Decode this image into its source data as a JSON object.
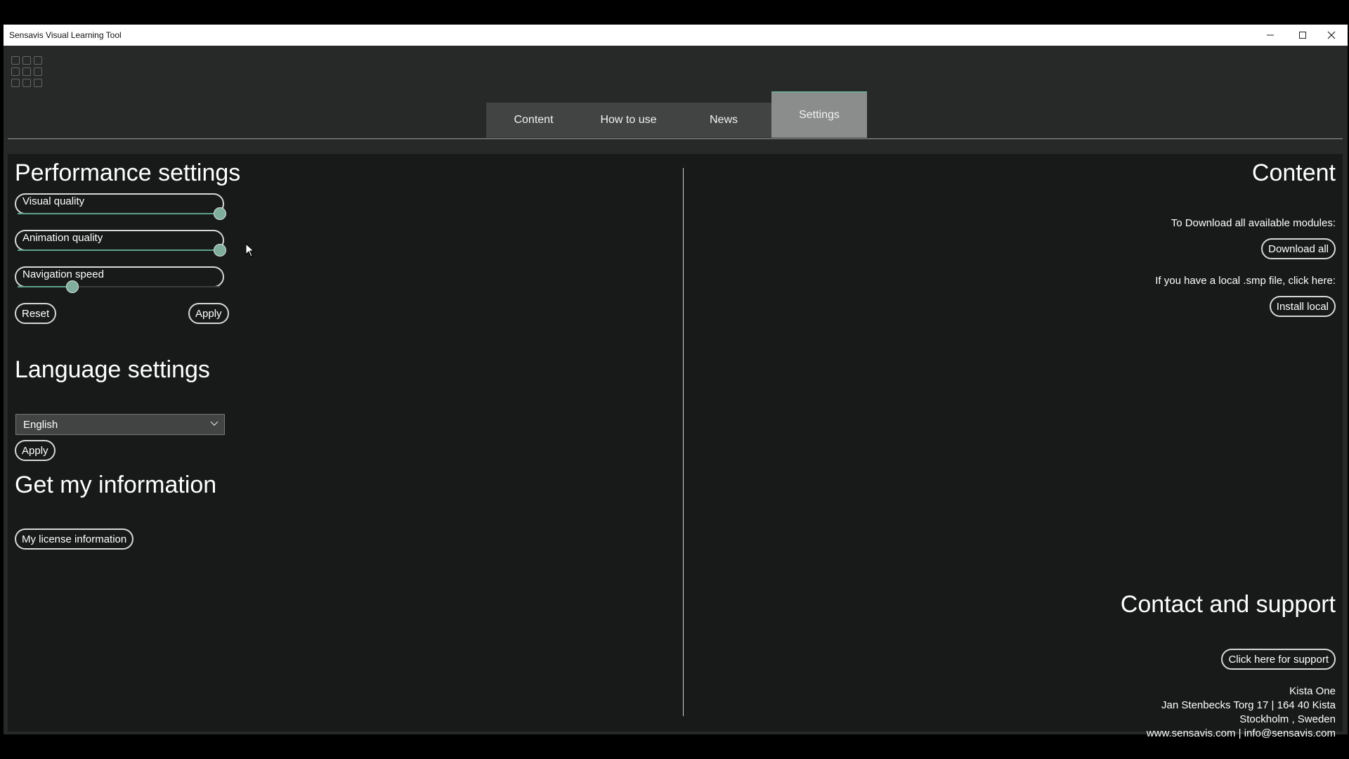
{
  "window": {
    "title": "Sensavis Visual Learning Tool"
  },
  "tabs": [
    {
      "label": "Content",
      "active": false
    },
    {
      "label": "How to use",
      "active": false
    },
    {
      "label": "News",
      "active": false
    },
    {
      "label": "Settings",
      "active": true
    }
  ],
  "performance": {
    "heading": "Performance settings",
    "sliders": [
      {
        "label": "Visual quality",
        "value_fraction": 1.0
      },
      {
        "label": "Animation quality",
        "value_fraction": 1.0
      },
      {
        "label": "Navigation speed",
        "value_fraction": 0.27
      }
    ],
    "reset_label": "Reset",
    "apply_label": "Apply"
  },
  "language": {
    "heading": "Language settings",
    "selected": "English",
    "apply_label": "Apply"
  },
  "info": {
    "heading": "Get my information",
    "license_label": "My license information"
  },
  "content": {
    "heading": "Content",
    "download_text": "To Download all available modules:",
    "download_label": "Download all",
    "local_text": "If you have a local .smp file, click here:",
    "install_label": "Install local"
  },
  "contact": {
    "heading": "Contact and support",
    "support_label": "Click here for support",
    "address_lines": [
      "Kista One",
      "Jan Stenbecks Torg 17 | 164 40 Kista",
      "Stockholm ,  Sweden",
      "www.sensavis.com |  info@sensavis.com"
    ]
  },
  "colors": {
    "accent": "#6fa895",
    "panel": "#171a19",
    "background": "#262928"
  }
}
